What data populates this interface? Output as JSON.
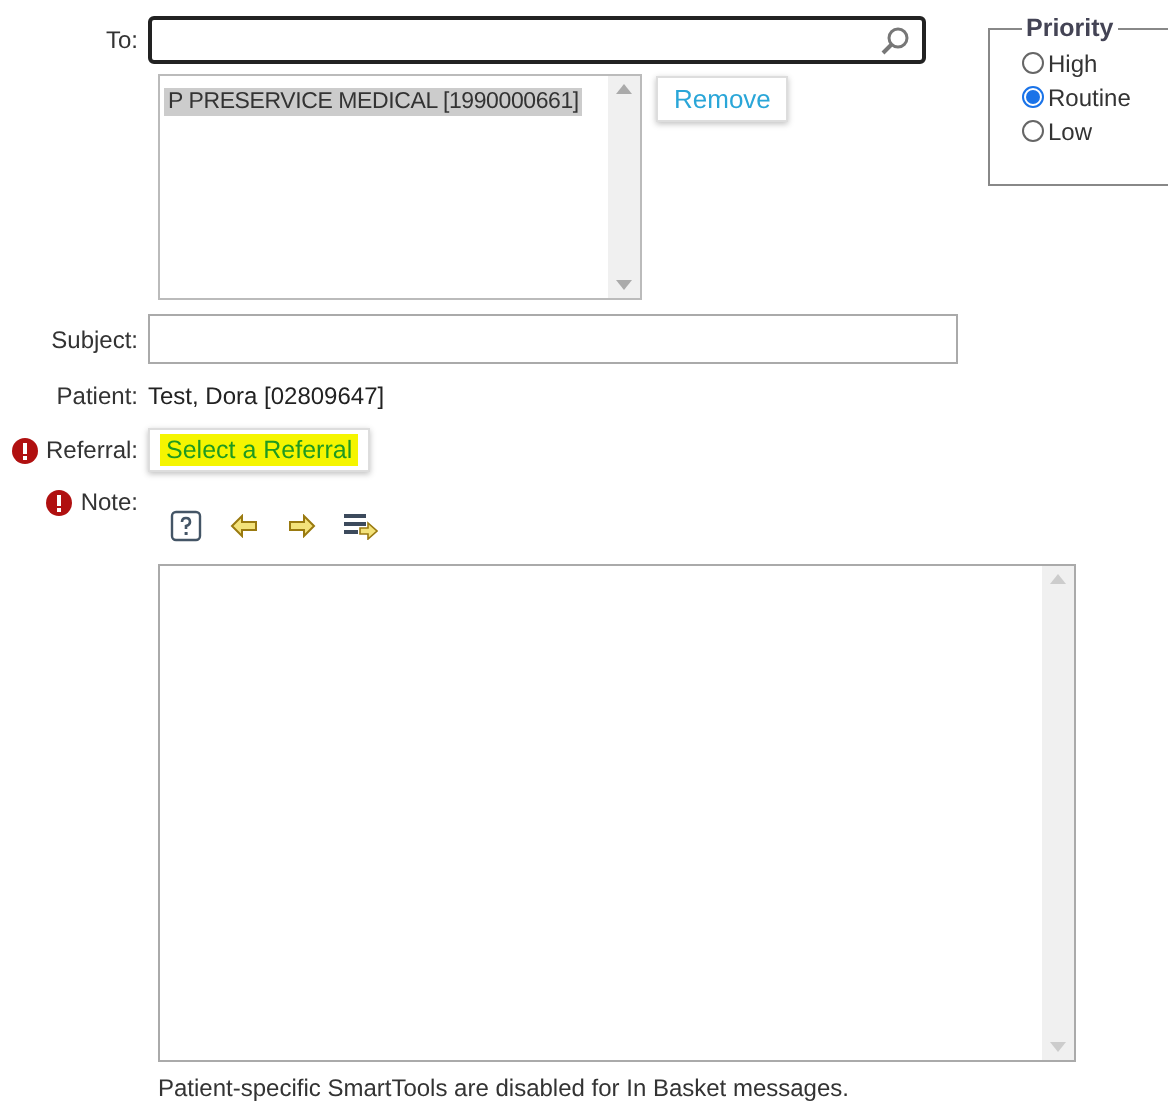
{
  "to": {
    "label": "To:"
  },
  "recipients": [
    {
      "name": "P PRESERVICE MEDICAL [1990000661]",
      "selected": true
    }
  ],
  "remove_button": "Remove",
  "priority": {
    "title": "Priority",
    "options": [
      {
        "label": "High",
        "selected": false
      },
      {
        "label": "Routine",
        "selected": true
      },
      {
        "label": "Low",
        "selected": false
      }
    ]
  },
  "subject": {
    "label": "Subject:"
  },
  "patient": {
    "label": "Patient:",
    "value": "Test, Dora [02809647]"
  },
  "referral": {
    "label": "Referral:",
    "required": true,
    "button": "Select a Referral"
  },
  "note": {
    "label": "Note:",
    "required": true,
    "toolbar": [
      {
        "kind": "help"
      },
      {
        "kind": "back"
      },
      {
        "kind": "forward"
      },
      {
        "kind": "insert"
      }
    ]
  },
  "footer": "Patient-specific SmartTools are disabled for In Basket messages."
}
